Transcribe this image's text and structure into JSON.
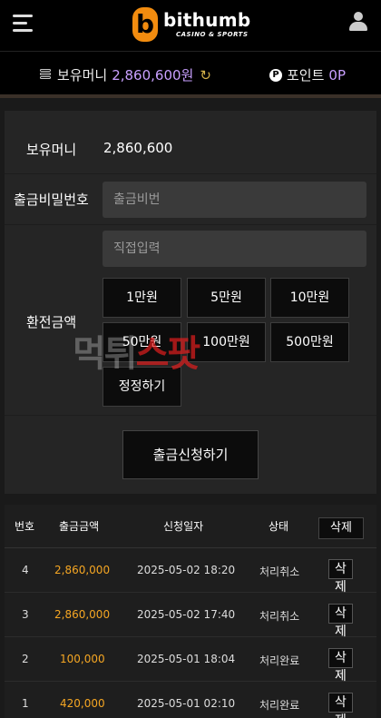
{
  "header": {
    "logo_letter": "b",
    "logo_text": "bithumb",
    "logo_sub": "CASINO & SPORTS"
  },
  "balance_bar": {
    "money_label": "보유머니",
    "money_value": "2,860,600원",
    "points_badge": "P",
    "points_label": "포인트",
    "points_value": "0P"
  },
  "form": {
    "balance_label": "보유머니",
    "balance_value": "2,860,600",
    "password_label": "출금비밀번호",
    "password_placeholder": "출금비번",
    "amount_label": "환전금액",
    "amount_placeholder": "직접입력",
    "amount_buttons": [
      "1만원",
      "5만원",
      "10만원",
      "50만원",
      "100만원",
      "500만원",
      "정정하기"
    ],
    "submit_label": "출금신청하기"
  },
  "watermark": {
    "part1": "먹튀",
    "part2": "스팟"
  },
  "table": {
    "headers": {
      "num": "번호",
      "amount": "출금금액",
      "date": "신청일자",
      "status": "상태",
      "delete": "삭제"
    },
    "rows": [
      {
        "num": "4",
        "amount": "2,860,000",
        "date": "2025-05-02 18:20",
        "status": "처리취소",
        "delete": "삭제"
      },
      {
        "num": "3",
        "amount": "2,860,000",
        "date": "2025-05-02 17:40",
        "status": "처리취소",
        "delete": "삭제"
      },
      {
        "num": "2",
        "amount": "100,000",
        "date": "2025-05-01 18:04",
        "status": "처리완료",
        "delete": "삭제"
      },
      {
        "num": "1",
        "amount": "420,000",
        "date": "2025-05-01 02:10",
        "status": "처리완료",
        "delete": "삭제"
      }
    ]
  },
  "colors": {
    "accent_purple": "#c9a0ff",
    "amount_orange": "#f5a623",
    "logo_orange": "#f28c0f"
  }
}
